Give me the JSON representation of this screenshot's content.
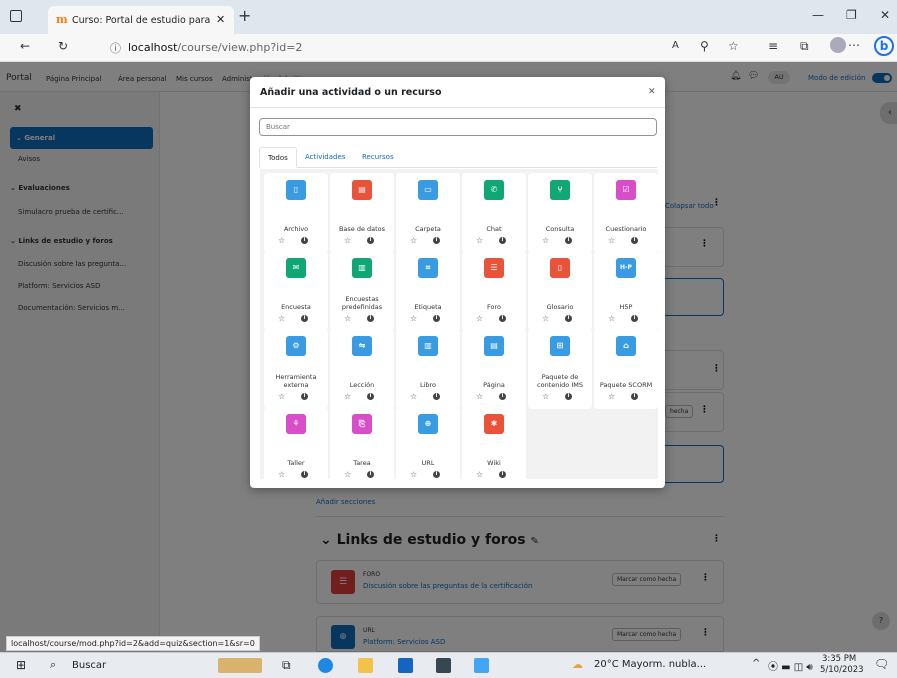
{
  "browser": {
    "tab_title": "Curso: Portal de estudio para la c",
    "url_host": "localhost",
    "url_path": "/course/view.php?id=2",
    "status_url": "localhost/course/mod.php?id=2&add=quiz&section=1&sr=0",
    "tab_favicon": "m"
  },
  "navbar": {
    "brand": "Portal",
    "links": [
      "Página Principal",
      "Área personal",
      "Mis cursos",
      "Administración del sitio"
    ],
    "user_initials": "AU",
    "edit_mode_label": "Modo de edición"
  },
  "drawer": {
    "section_general": "General",
    "avisos": "Avisos",
    "section_eval": "Evaluaciones",
    "simulacro": "Simulacro prueba de certific...",
    "section_links": "Links de estudio y foros",
    "item1": "Discusión sobre las pregunta...",
    "item2": "Platform: Servicios ASD",
    "item3": "Documentación: Servicios m..."
  },
  "course": {
    "collapse_all": "Colapsar todo",
    "add_sections": "Añadir secciones",
    "section_title": "Links de estudio y foros",
    "activities": [
      {
        "type": "FORO",
        "name": "Discusión sobre las preguntas de la certificación",
        "button": "Marcar como hecha",
        "color": "#e23c3c"
      },
      {
        "type": "URL",
        "name": "Platform: Servicios ASD",
        "button": "Marcar como hecha",
        "color": "#0f6cbf"
      }
    ],
    "partial_button": "hecha"
  },
  "modal": {
    "title": "Añadir una actividad o un recurso",
    "search_placeholder": "Buscar",
    "tabs": [
      "Todos",
      "Actividades",
      "Recursos"
    ],
    "items": [
      {
        "name": "Archivo",
        "color": "#399be2",
        "icon": "file-icon"
      },
      {
        "name": "Base de datos",
        "color": "#e8533a",
        "icon": "database-icon"
      },
      {
        "name": "Carpeta",
        "color": "#399be2",
        "icon": "folder-icon"
      },
      {
        "name": "Chat",
        "color": "#11a676",
        "icon": "chat-icon"
      },
      {
        "name": "Consulta",
        "color": "#11a676",
        "icon": "choice-icon"
      },
      {
        "name": "Cuestionario",
        "color": "#d94ec8",
        "icon": "quiz-icon"
      },
      {
        "name": "Encuesta",
        "color": "#11a676",
        "icon": "feedback-icon"
      },
      {
        "name": "Encuestas predefinidas",
        "color": "#11a676",
        "icon": "survey-icon"
      },
      {
        "name": "Etiqueta",
        "color": "#399be2",
        "icon": "label-icon"
      },
      {
        "name": "Foro",
        "color": "#e8533a",
        "icon": "forum-icon"
      },
      {
        "name": "Glosario",
        "color": "#e8533a",
        "icon": "glossary-icon"
      },
      {
        "name": "H5P",
        "color": "#399be2",
        "icon": "h5p-icon"
      },
      {
        "name": "Herramienta externa",
        "color": "#399be2",
        "icon": "lti-icon"
      },
      {
        "name": "Lección",
        "color": "#399be2",
        "icon": "lesson-icon"
      },
      {
        "name": "Libro",
        "color": "#399be2",
        "icon": "book-icon"
      },
      {
        "name": "Página",
        "color": "#399be2",
        "icon": "page-icon"
      },
      {
        "name": "Paquete de contenido IMS",
        "color": "#399be2",
        "icon": "imscp-icon"
      },
      {
        "name": "Paquete SCORM",
        "color": "#399be2",
        "icon": "scorm-icon"
      },
      {
        "name": "Taller",
        "color": "#d94ec8",
        "icon": "workshop-icon"
      },
      {
        "name": "Tarea",
        "color": "#d94ec8",
        "icon": "assignment-icon"
      },
      {
        "name": "URL",
        "color": "#399be2",
        "icon": "url-icon"
      },
      {
        "name": "Wiki",
        "color": "#e8533a",
        "icon": "wiki-icon"
      }
    ]
  },
  "taskbar": {
    "search": "Buscar",
    "weather": "20°C  Mayorm. nubla...",
    "time": "3:35 PM",
    "date": "5/10/2023"
  }
}
